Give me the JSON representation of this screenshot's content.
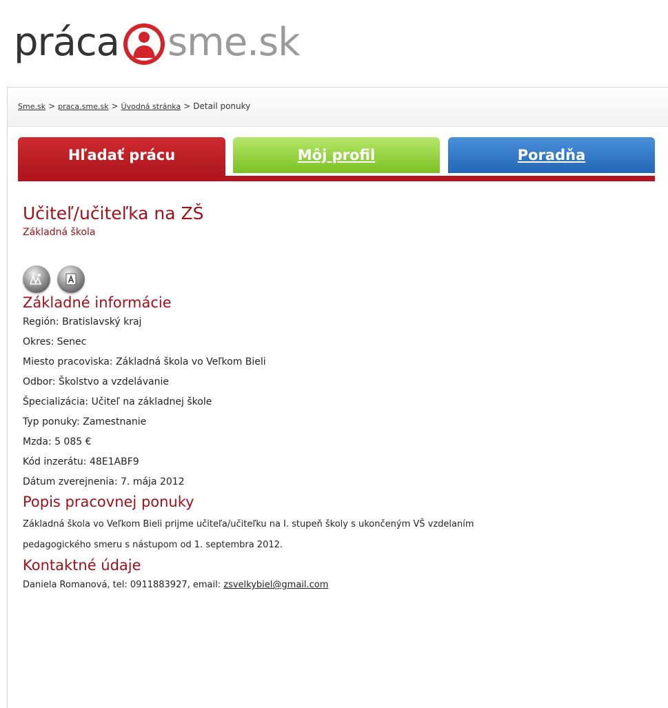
{
  "logo": {
    "part_a": "práca",
    "part_b": "sme.sk"
  },
  "breadcrumb": {
    "items": [
      "Sme.sk",
      "praca.sme.sk",
      "Úvodná stránka"
    ],
    "current": "Detail ponuky",
    "separator": ">"
  },
  "tabs": {
    "hladat": "Hľadať prácu",
    "profil": "Môj profil",
    "poradna": "Poradňa"
  },
  "job": {
    "title": "Učiteľ/učiteľka na ZŠ",
    "employer": "Základná škola"
  },
  "icons": [
    "map-icon",
    "language-icon"
  ],
  "basic_info": {
    "heading": "Základné informácie",
    "rows": [
      {
        "label": "Región:",
        "value": "Bratislavský kraj"
      },
      {
        "label": "Okres:",
        "value": "Senec"
      },
      {
        "label": "Miesto pracoviska:",
        "value": "Základná škola vo Veľkom Bieli"
      },
      {
        "label": "Odbor:",
        "value": "Školstvo a vzdelávanie"
      },
      {
        "label": "Špecializácia:",
        "value": "Učiteľ na základnej škole"
      },
      {
        "label": "Typ ponuky:",
        "value": "Zamestnanie"
      },
      {
        "label": "Mzda:",
        "value": "5 085 €"
      },
      {
        "label": "Kód inzerátu:",
        "value": "48E1ABF9"
      },
      {
        "label": "Dátum zverejnenia:",
        "value": "7. mája 2012"
      }
    ]
  },
  "description": {
    "heading": "Popis pracovnej ponuky",
    "line1": "Základná škola vo Veľkom Bieli prijme učiteľa/učiteľku na I. stupeň školy s ukončeným VŠ vzdelaním",
    "line2": "pedagogického smeru s nástupom od 1. septembra 2012."
  },
  "contact": {
    "heading": "Kontaktné údaje",
    "text": "Daniela Romanová, tel: 0911883927, email:",
    "email": "zsvelkybiel@gmail.com"
  },
  "colors": {
    "brand_red": "#a3101a",
    "tab_red": "#b5151d",
    "tab_green": "#7cc024",
    "tab_blue": "#2266b5"
  }
}
